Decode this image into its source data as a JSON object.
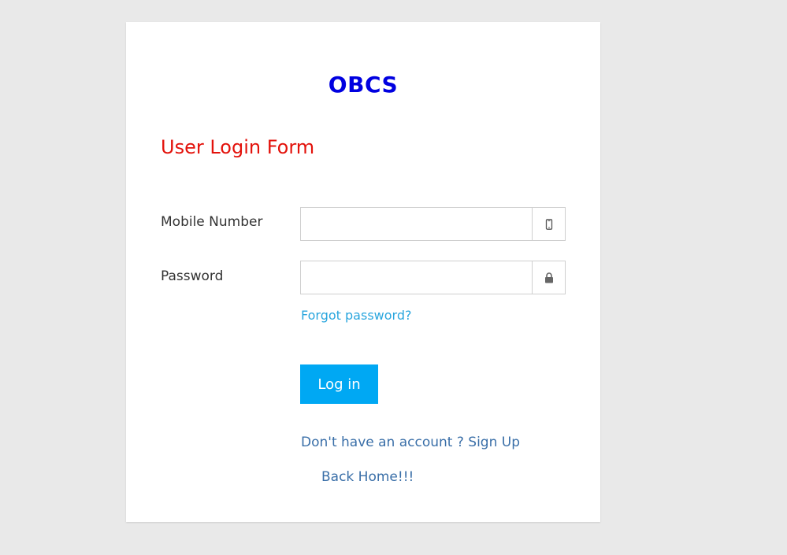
{
  "brand": {
    "title": "OBCS",
    "color": "#0000e0"
  },
  "form": {
    "title": "User Login Form",
    "title_color": "#e3120b",
    "mobile": {
      "label": "Mobile Number",
      "value": "",
      "placeholder": "",
      "icon": "mobile-phone-icon"
    },
    "password": {
      "label": "Password",
      "value": "",
      "placeholder": "",
      "icon": "lock-icon"
    },
    "forgot_label": "Forgot password?",
    "login_label": "Log in",
    "login_color": "#00a8f3",
    "signup_prefix": "Don't have an account ? ",
    "signup_label": "Sign Up",
    "back_home_label": "Back Home!!!"
  }
}
